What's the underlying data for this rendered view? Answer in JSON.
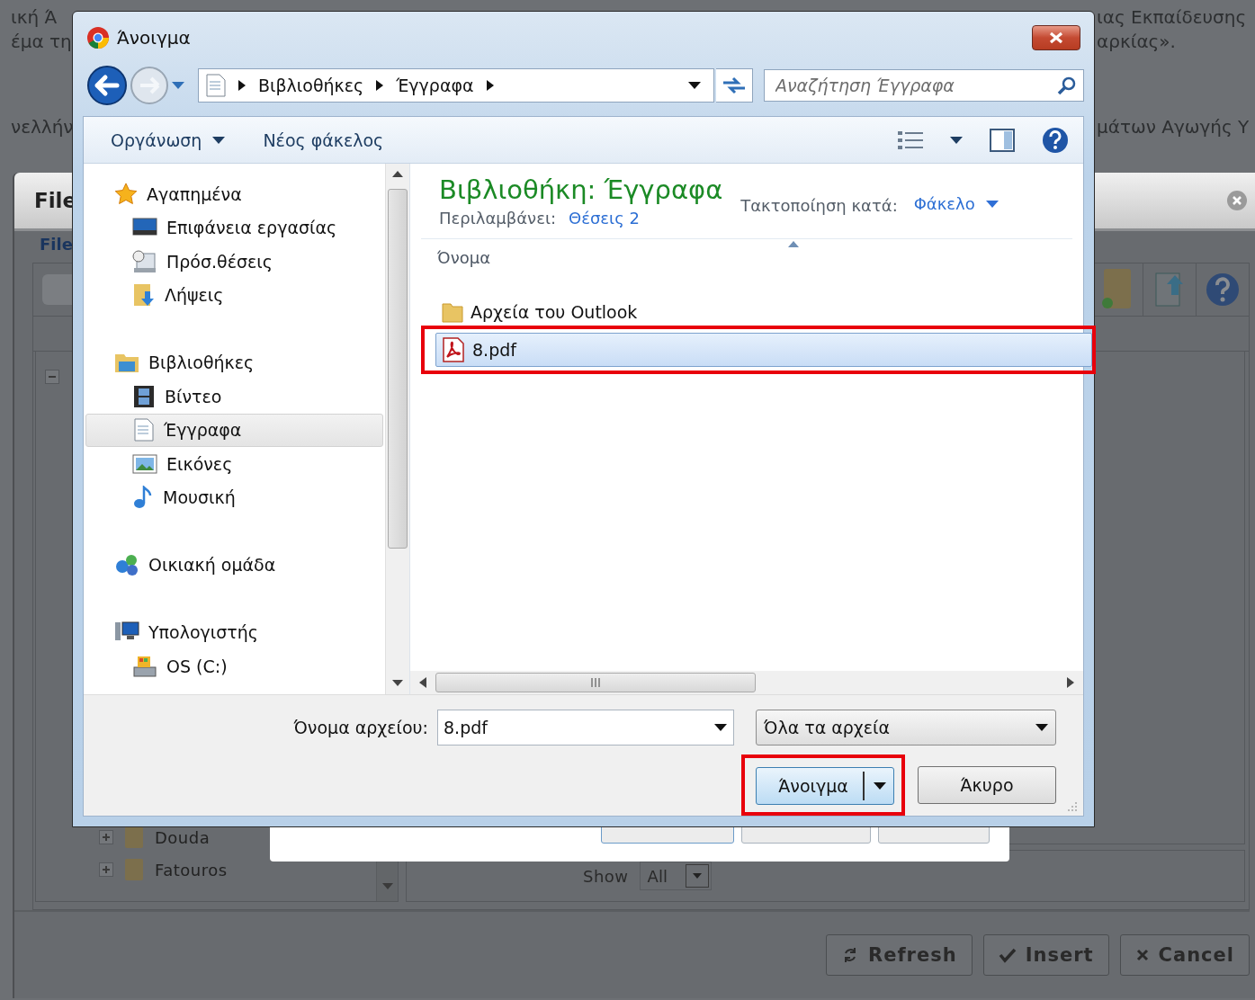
{
  "page_fragments_left": [
    "ική Ά",
    "έμα τη",
    "νελλήν"
  ],
  "page_fragments_right": [
    "ιας Εκπαίδευσης",
    "αρκίας».",
    "μάτων Αγωγής Υ"
  ],
  "file_manager": {
    "title": "File",
    "legend": "File",
    "tree": [
      {
        "label": "Douda",
        "expanded": false
      },
      {
        "label": "Fatouros",
        "expanded": false
      }
    ],
    "show_label": "Show",
    "show_value": "All",
    "buttons": [
      {
        "label": "Refresh",
        "kind": "refresh"
      },
      {
        "label": "Insert",
        "kind": "insert"
      },
      {
        "label": "Cancel",
        "kind": "cancel"
      }
    ]
  },
  "dialog": {
    "title": "Άνοιγμα",
    "breadcrumb": [
      "Βιβλιοθήκες",
      "Έγγραφα"
    ],
    "search": {
      "placeholder": "Αναζήτηση Έγγραφα"
    },
    "toolbar": [
      {
        "label": "Οργάνωση",
        "has_menu": true
      },
      {
        "label": "Νέος φάκελος",
        "has_menu": false
      }
    ],
    "nav": [
      {
        "label": "Αγαπημένα",
        "selected": false,
        "children": [
          {
            "label": "Επιφάνεια εργασίας",
            "selected": false
          },
          {
            "label": "Πρόσ.θέσεις",
            "selected": false
          },
          {
            "label": "Λήψεις",
            "selected": false
          }
        ]
      },
      {
        "label": "Βιβλιοθήκες",
        "selected": false,
        "children": [
          {
            "label": "Βίντεο",
            "selected": false
          },
          {
            "label": "Έγγραφα",
            "selected": true
          },
          {
            "label": "Εικόνες",
            "selected": false
          },
          {
            "label": "Μουσική",
            "selected": false
          }
        ]
      },
      {
        "label": "Οικιακή ομάδα",
        "selected": false
      },
      {
        "label": "Υπολογιστής",
        "selected": false,
        "children": [
          {
            "label": "OS (C:)",
            "selected": false
          }
        ]
      }
    ],
    "library": {
      "title": "Βιβλιοθήκη: Έγγραφα",
      "includes_label": "Περιλαμβάνει:",
      "includes_link": "Θέσεις 2",
      "arrange_label": "Τακτοποίηση κατά:",
      "arrange_value": "Φάκελο"
    },
    "column": "Όνομα",
    "files": [
      {
        "name": "Αρχεία του Outlook",
        "kind": "folder",
        "selected": false,
        "highlighted": false
      },
      {
        "name": "8.pdf",
        "kind": "pdf",
        "selected": true,
        "highlighted": true
      }
    ],
    "filename_label": "Όνομα αρχείου:",
    "filename": "8.pdf",
    "filter": "Όλα τα αρχεία",
    "open_button": {
      "label": "Άνοιγμα",
      "highlighted": true
    },
    "cancel_button": "Άκυρο"
  }
}
